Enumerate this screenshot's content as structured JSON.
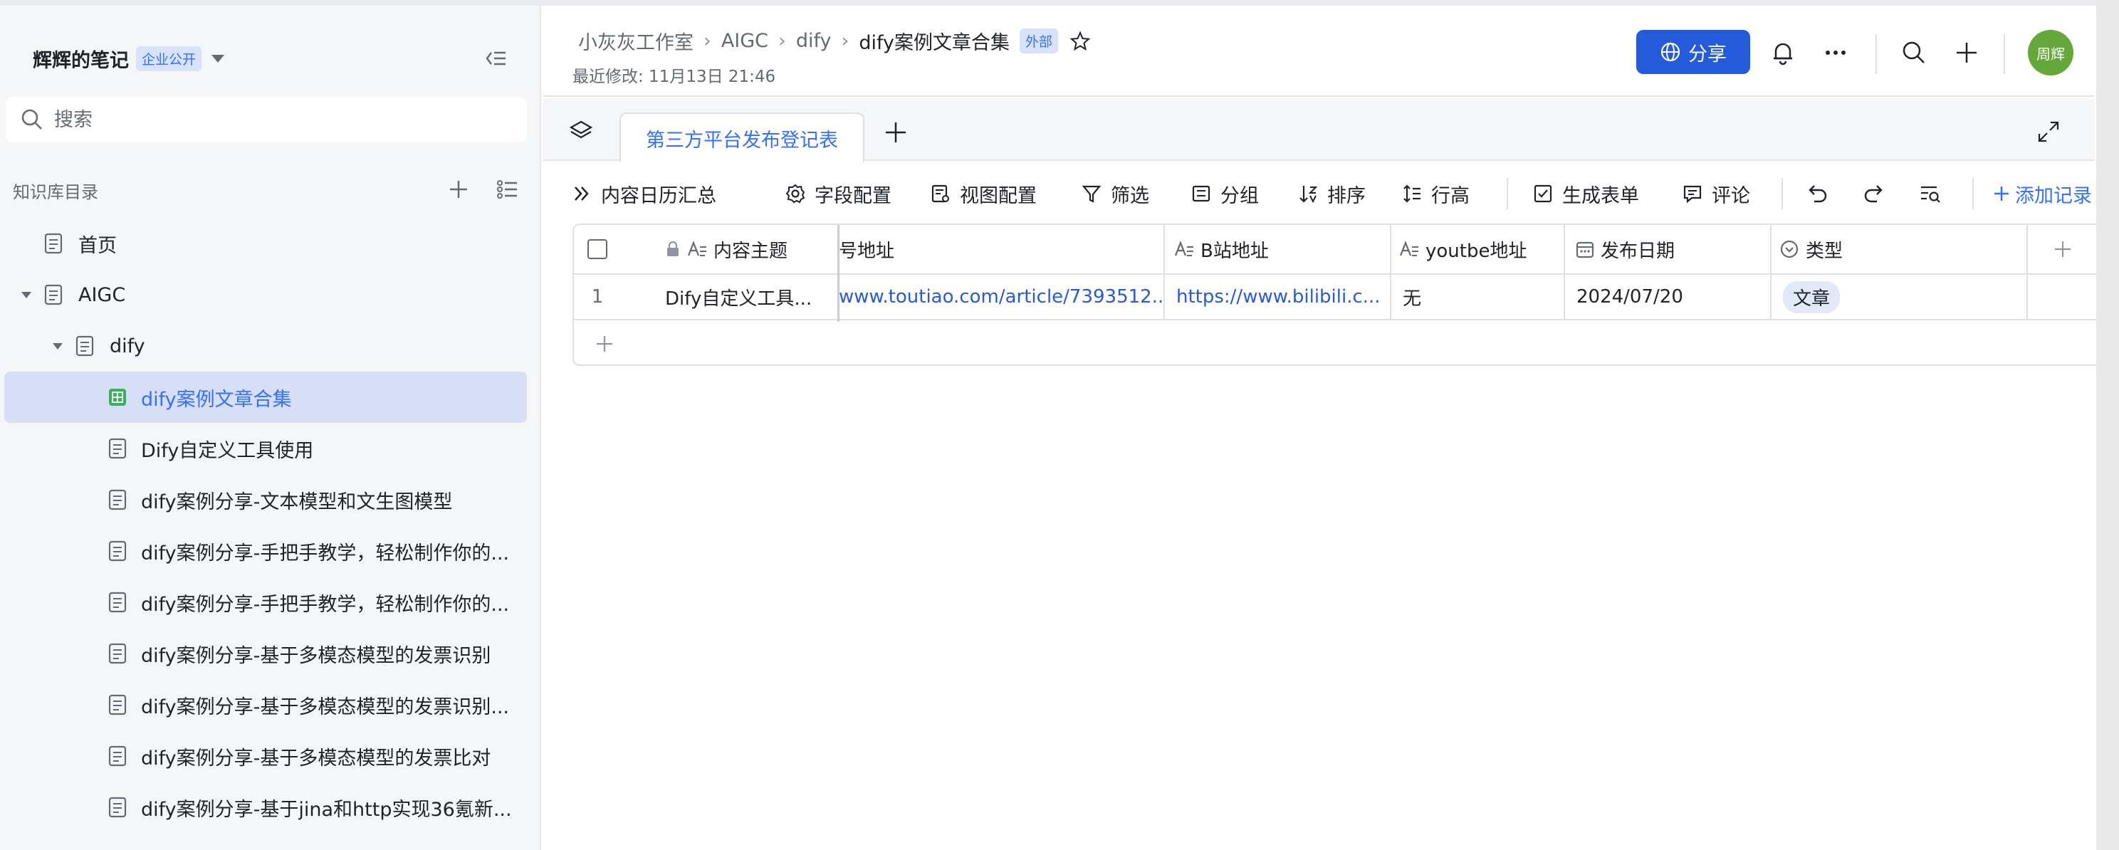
{
  "sidebar": {
    "title": "辉辉的笔记",
    "badge": "企业公开",
    "search_placeholder": "搜索",
    "dir_label": "知识库目录",
    "tree": [
      {
        "label": "首页"
      },
      {
        "label": "AIGC"
      },
      {
        "label": "dify"
      },
      {
        "label": "dify案例文章合集"
      },
      {
        "label": "Dify自定义工具使用"
      },
      {
        "label": "dify案例分享-文本模型和文生图模型"
      },
      {
        "label": "dify案例分享-手把手教学，轻松制作你的..."
      },
      {
        "label": "dify案例分享-手把手教学，轻松制作你的..."
      },
      {
        "label": "dify案例分享-基于多模态模型的发票识别"
      },
      {
        "label": "dify案例分享-基于多模态模型的发票识别..."
      },
      {
        "label": "dify案例分享-基于多模态模型的发票比对"
      },
      {
        "label": "dify案例分享-基于jina和http实现36氪新..."
      }
    ]
  },
  "header": {
    "breadcrumbs": [
      "小灰灰工作室",
      "AIGC",
      "dify",
      "dify案例文章合集"
    ],
    "ext_badge": "外部",
    "modified": "最近修改: 11月13日 21:46",
    "share_label": "分享",
    "avatar": "周辉"
  },
  "tabs": {
    "active": "第三方平台发布登记表"
  },
  "toolbar": {
    "calendar": "内容日历汇总",
    "fields": "字段配置",
    "view": "视图配置",
    "filter": "筛选",
    "group": "分组",
    "sort": "排序",
    "row_height": "行高",
    "form": "生成表单",
    "comment": "评论",
    "add_record": "添加记录"
  },
  "table": {
    "headers": [
      "内容主题",
      "号地址",
      "B站地址",
      "youtbe地址",
      "发布日期",
      "类型"
    ],
    "rows": [
      {
        "index": "1",
        "topic": "Dify自定义工具...",
        "toutiao": "www.toutiao.com/article/7393512...",
        "bilibili": "https://www.bilibili.c...",
        "youtube": "无",
        "date": "2024/07/20",
        "type": "文章"
      }
    ]
  },
  "colors": {
    "accent": "#3370ff",
    "share_bg": "#245bdb",
    "active_item_bg": "#d6dff7",
    "avatar_bg": "#65a83a"
  }
}
